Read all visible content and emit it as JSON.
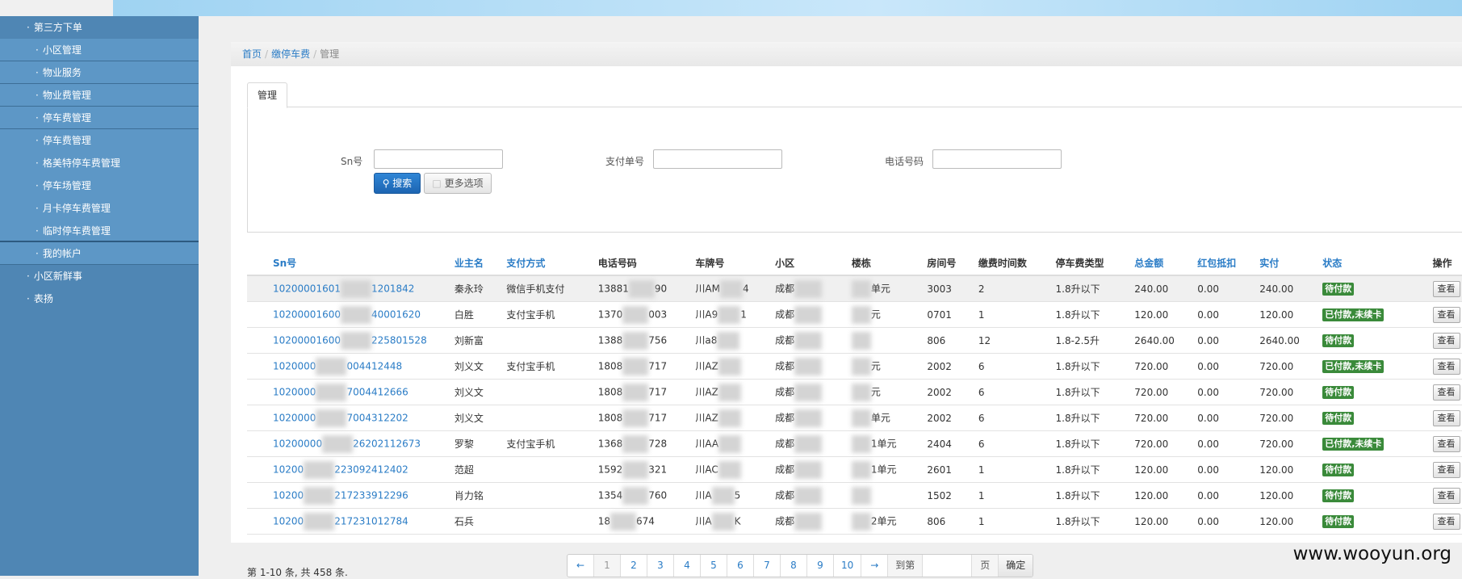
{
  "sidebar": {
    "items": [
      {
        "label": "第三方下单",
        "level": "top"
      },
      {
        "label": "小区管理",
        "level": "sub"
      },
      {
        "label": "物业服务",
        "level": "sub"
      },
      {
        "label": "物业费管理",
        "level": "sub"
      },
      {
        "label": "停车费管理",
        "level": "sub"
      },
      {
        "label": "停车费管理",
        "level": "sub2"
      },
      {
        "label": "格美特停车费管理",
        "level": "sub2"
      },
      {
        "label": "停车场管理",
        "level": "sub2"
      },
      {
        "label": "月卡停车费管理",
        "level": "sub2"
      },
      {
        "label": "临时停车费管理",
        "level": "sub2"
      },
      {
        "label": "我的帐户",
        "level": "sub"
      },
      {
        "label": "小区新鲜事",
        "level": "top"
      },
      {
        "label": "表扬",
        "level": "top"
      }
    ]
  },
  "breadcrumb": {
    "home": "首页",
    "section": "缴停车费",
    "current": "管理"
  },
  "tab": {
    "label": "管理"
  },
  "filters": {
    "sn_label": "Sn号",
    "pay_label": "支付单号",
    "phone_label": "电话号码",
    "search_label": "搜索",
    "more_label": "更多选项"
  },
  "table": {
    "headers": [
      "Sn号",
      "业主名",
      "支付方式",
      "电话号码",
      "车牌号",
      "小区",
      "楼栋",
      "房间号",
      "缴费时间数",
      "停车费类型",
      "总金额",
      "红包抵扣",
      "实付",
      "状态",
      "操作"
    ],
    "rows": [
      {
        "sn_a": "10200001601",
        "sn_b": "1201842",
        "owner": "秦永玲",
        "pay": "微信手机支付",
        "phone_a": "13881",
        "phone_b": "90",
        "plate": "川AM",
        "plate_b": "4",
        "community": "成都",
        "building": "",
        "building_b": "单元",
        "room": "3003",
        "months": "2",
        "type": "1.8升以下",
        "total": "240.00",
        "redpack": "0.00",
        "paid": "240.00",
        "status": "待付款",
        "action": "查看"
      },
      {
        "sn_a": "10200001600",
        "sn_b": "40001620",
        "owner": "白胜",
        "pay": "支付宝手机",
        "phone_a": "1370",
        "phone_b": "003",
        "plate": "川A9",
        "plate_b": "1",
        "community": "成都",
        "building": "",
        "building_b": "元",
        "room": "0701",
        "months": "1",
        "type": "1.8升以下",
        "total": "120.00",
        "redpack": "0.00",
        "paid": "120.00",
        "status": "已付款,未续卡",
        "action": "查看"
      },
      {
        "sn_a": "10200001600",
        "sn_b": "225801528",
        "owner": "刘新富",
        "pay": "",
        "phone_a": "1388",
        "phone_b": "756",
        "plate": "川a8",
        "plate_b": "",
        "community": "成都",
        "building": "",
        "building_b": "",
        "room": "806",
        "months": "12",
        "type": "1.8-2.5升",
        "total": "2640.00",
        "redpack": "0.00",
        "paid": "2640.00",
        "status": "待付款",
        "action": "查看"
      },
      {
        "sn_a": "1020000",
        "sn_b": "004412448",
        "owner": "刘义文",
        "pay": "支付宝手机",
        "phone_a": "1808",
        "phone_b": "717",
        "plate": "川AZ",
        "plate_b": "",
        "community": "成都",
        "building": "",
        "building_b": "元",
        "room": "2002",
        "months": "6",
        "type": "1.8升以下",
        "total": "720.00",
        "redpack": "0.00",
        "paid": "720.00",
        "status": "已付款,未续卡",
        "action": "查看"
      },
      {
        "sn_a": "1020000",
        "sn_b": "7004412666",
        "owner": "刘义文",
        "pay": "",
        "phone_a": "1808",
        "phone_b": "717",
        "plate": "川AZ",
        "plate_b": "",
        "community": "成都",
        "building": "",
        "building_b": "元",
        "room": "2002",
        "months": "6",
        "type": "1.8升以下",
        "total": "720.00",
        "redpack": "0.00",
        "paid": "720.00",
        "status": "待付款",
        "action": "查看"
      },
      {
        "sn_a": "1020000",
        "sn_b": "7004312202",
        "owner": "刘义文",
        "pay": "",
        "phone_a": "1808",
        "phone_b": "717",
        "plate": "川AZ",
        "plate_b": "",
        "community": "成都",
        "building": "",
        "building_b": "单元",
        "room": "2002",
        "months": "6",
        "type": "1.8升以下",
        "total": "720.00",
        "redpack": "0.00",
        "paid": "720.00",
        "status": "待付款",
        "action": "查看"
      },
      {
        "sn_a": "10200000",
        "sn_b": "26202112673",
        "owner": "罗黎",
        "pay": "支付宝手机",
        "phone_a": "1368",
        "phone_b": "728",
        "plate": "川AA",
        "plate_b": "",
        "community": "成都",
        "building": "",
        "building_b": "1单元",
        "room": "2404",
        "months": "6",
        "type": "1.8升以下",
        "total": "720.00",
        "redpack": "0.00",
        "paid": "720.00",
        "status": "已付款,未续卡",
        "action": "查看"
      },
      {
        "sn_a": "10200",
        "sn_b": "223092412402",
        "owner": "范超",
        "pay": "",
        "phone_a": "1592",
        "phone_b": "321",
        "plate": "川AC",
        "plate_b": "",
        "community": "成都",
        "building": "",
        "building_b": "1单元",
        "room": "2601",
        "months": "1",
        "type": "1.8升以下",
        "total": "120.00",
        "redpack": "0.00",
        "paid": "120.00",
        "status": "待付款",
        "action": "查看"
      },
      {
        "sn_a": "10200",
        "sn_b": "217233912296",
        "owner": "肖力铭",
        "pay": "",
        "phone_a": "1354",
        "phone_b": "760",
        "plate": "川A",
        "plate_b": "5",
        "community": "成都",
        "building": "",
        "building_b": "",
        "room": "1502",
        "months": "1",
        "type": "1.8升以下",
        "total": "120.00",
        "redpack": "0.00",
        "paid": "120.00",
        "status": "待付款",
        "action": "查看"
      },
      {
        "sn_a": "10200",
        "sn_b": "217231012784",
        "owner": "石兵",
        "pay": "",
        "phone_a": "18",
        "phone_b": "674",
        "plate": "川A",
        "plate_b": "K",
        "community": "成都",
        "building": "",
        "building_b": "2单元",
        "room": "806",
        "months": "1",
        "type": "1.8升以下",
        "total": "120.00",
        "redpack": "0.00",
        "paid": "120.00",
        "status": "待付款",
        "action": "查看"
      }
    ]
  },
  "pagination": {
    "info": "第 1-10 条, 共 458 条.",
    "prev": "←",
    "pages": [
      "1",
      "2",
      "3",
      "4",
      "5",
      "6",
      "7",
      "8",
      "9",
      "10"
    ],
    "next": "→",
    "goto_label": "到第",
    "page_unit": "页",
    "confirm": "确定"
  },
  "watermark": "www.wooyun.org",
  "colors": {
    "sidebar": "#4f86b4",
    "link": "#2a7cc6",
    "badge": "#3a8a3a",
    "primary_button": "#1d65b2"
  }
}
